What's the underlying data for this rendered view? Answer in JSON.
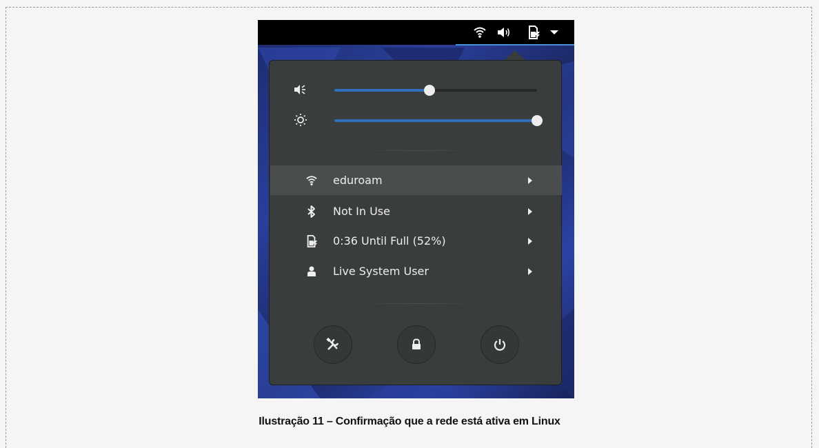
{
  "topbar": {
    "tray_icons": [
      "wifi-icon",
      "volume-icon",
      "battery-icon",
      "dropdown-arrow-icon"
    ]
  },
  "system_menu": {
    "volume": {
      "icon": "volume-icon",
      "level": 0.47
    },
    "brightness": {
      "icon": "brightness-icon",
      "level": 1.0
    },
    "items": [
      {
        "icon": "wifi-icon",
        "label": "eduroam",
        "active": true
      },
      {
        "icon": "bluetooth-icon",
        "label": "Not In Use",
        "active": false
      },
      {
        "icon": "battery-icon",
        "label": "0:36 Until Full (52%)",
        "active": false
      },
      {
        "icon": "user-icon",
        "label": "Live System User",
        "active": false
      }
    ],
    "buttons": [
      "settings-icon",
      "lock-icon",
      "power-icon"
    ]
  },
  "caption": "Ilustração 11 – Confirmação que a rede está ativa em Linux",
  "colors": {
    "topbar": "#000000",
    "popup_bg": "#3a3d3d",
    "active_item_bg": "#4a4d4d",
    "slider_fill": "#2f6fbd",
    "text": "#eeeeec",
    "desktop": "#2a3f9a"
  }
}
